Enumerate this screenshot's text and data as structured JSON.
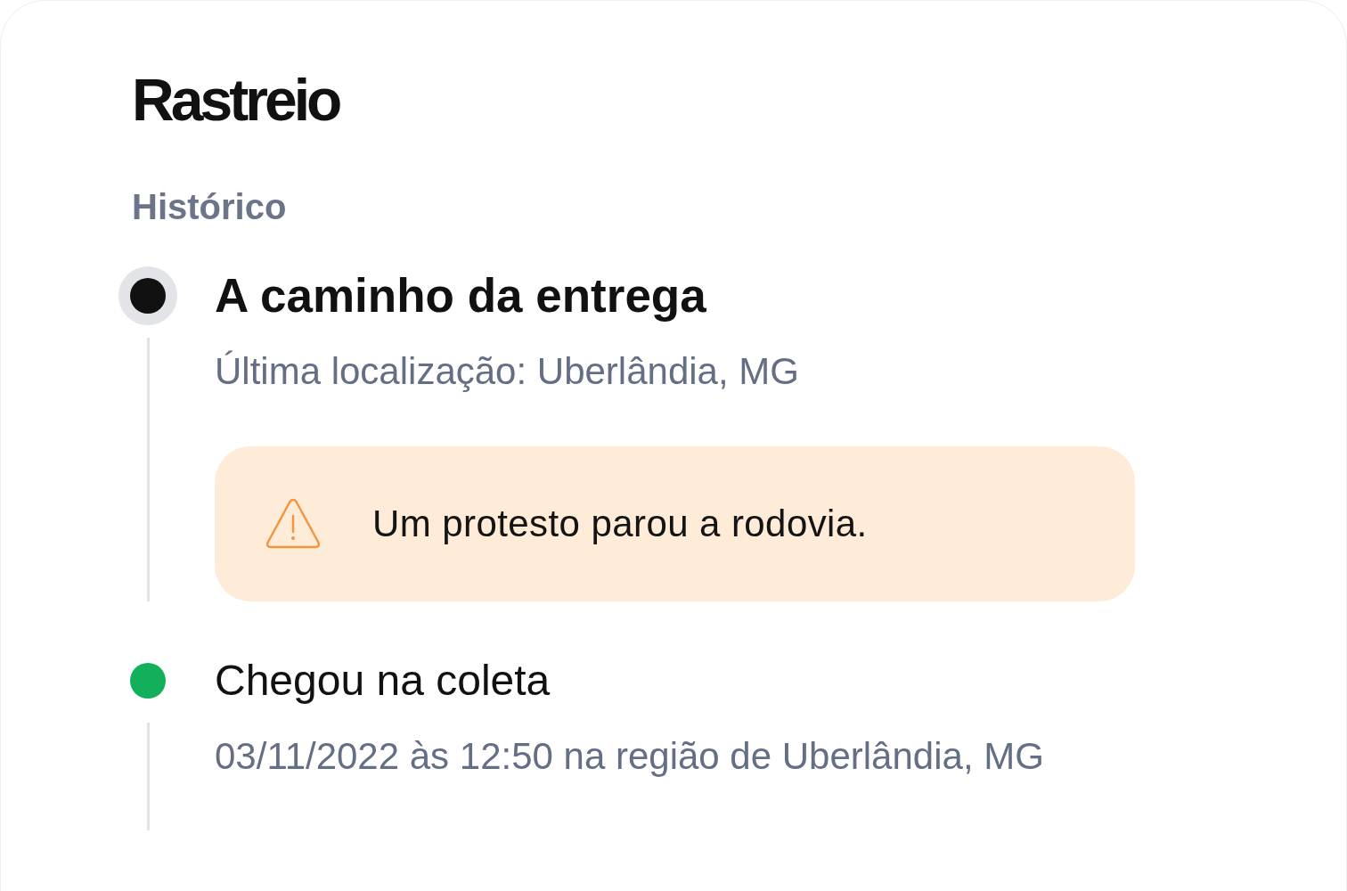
{
  "page": {
    "title": "Rastreio"
  },
  "history": {
    "heading": "Histórico",
    "events": [
      {
        "kind": "current",
        "color": "#111111",
        "title": "A caminho da entrega",
        "detail": "Última localização: Uberlândia, MG",
        "alert": {
          "kind": "warning",
          "text": "Um protesto parou a rodovia."
        }
      },
      {
        "kind": "done",
        "color": "#12b05b",
        "title": "Chegou na coleta",
        "detail": "03/11/2022 às 12:50 na região de Uberlândia, MG"
      }
    ]
  }
}
